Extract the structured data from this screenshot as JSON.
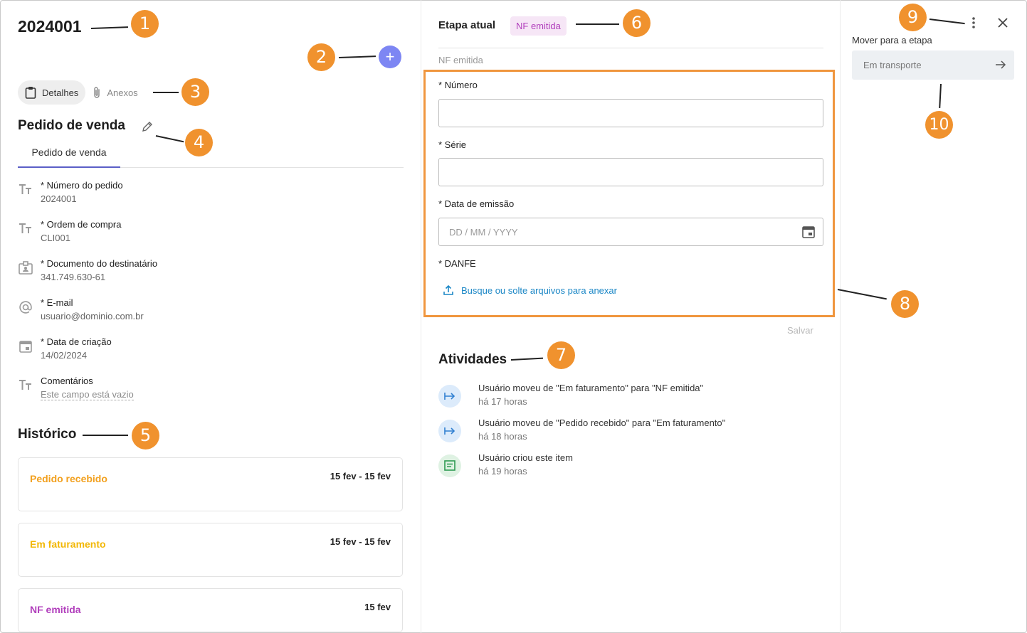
{
  "item": {
    "id": "2024001",
    "add_label": "+"
  },
  "tabs": [
    {
      "label": "Detalhes",
      "icon": "clipboard-icon",
      "active": true
    },
    {
      "label": "Anexos",
      "icon": "paperclip-icon",
      "active": false
    }
  ],
  "section": {
    "title": "Pedido de venda",
    "subtab": "Pedido de venda"
  },
  "fields": [
    {
      "label": "* Número do pedido",
      "value": "2024001",
      "icon": "text-type-icon"
    },
    {
      "label": "* Ordem de compra",
      "value": "CLI001",
      "icon": "text-type-icon"
    },
    {
      "label": "* Documento do destinatário",
      "value": "341.749.630-61",
      "icon": "id-card-icon"
    },
    {
      "label": "* E-mail",
      "value": "usuario@dominio.com.br",
      "icon": "at-sign-icon"
    },
    {
      "label": "* Data de criação",
      "value": "14/02/2024",
      "icon": "calendar-icon"
    },
    {
      "label": "Comentários",
      "value": "Este campo está vazio",
      "icon": "text-type-icon"
    }
  ],
  "history": {
    "title": "Histórico",
    "items": [
      {
        "name": "Pedido recebido",
        "dates": "15 fev - 15 fev",
        "color": "#f2a01e"
      },
      {
        "name": "Em faturamento",
        "dates": "15 fev - 15 fev",
        "color": "#f2b705"
      },
      {
        "name": "NF emitida",
        "dates": "15 fev",
        "color": "#b13fbc"
      }
    ]
  },
  "stage": {
    "label": "Etapa atual",
    "current": "NF emitida",
    "sub": "NF emitida"
  },
  "form": {
    "numero_label": "* Número",
    "serie_label": "* Série",
    "data_label": "* Data de emissão",
    "data_placeholder": "DD / MM / YYYY",
    "danfe_label": "* DANFE",
    "upload_text": "Busque ou solte arquivos para anexar",
    "save_label": "Salvar"
  },
  "activities": {
    "title": "Atividades",
    "items": [
      {
        "text": "Usuário moveu de \"Em faturamento\" para \"NF emitida\"",
        "time": "há 17 horas",
        "icon": "move-arrow-icon",
        "color": "#dcebfb"
      },
      {
        "text": "Usuário moveu de \"Pedido recebido\" para \"Em faturamento\"",
        "time": "há 18 horas",
        "icon": "move-arrow-icon",
        "color": "#dcebfb"
      },
      {
        "text": "Usuário criou este item",
        "time": "há 19 horas",
        "icon": "note-icon",
        "color": "#dff2e3"
      }
    ]
  },
  "right": {
    "move_label": "Mover para a etapa",
    "move_value": "Em transporte"
  },
  "annotations": [
    "1",
    "2",
    "3",
    "4",
    "5",
    "6",
    "7",
    "8",
    "9",
    "10"
  ],
  "colors": {
    "accent": "#7d86f3",
    "tab_underline": "#5b5fc7",
    "annotation": "#f0922e",
    "link": "#1b87c6",
    "badge_bg": "#f6e6f6"
  }
}
